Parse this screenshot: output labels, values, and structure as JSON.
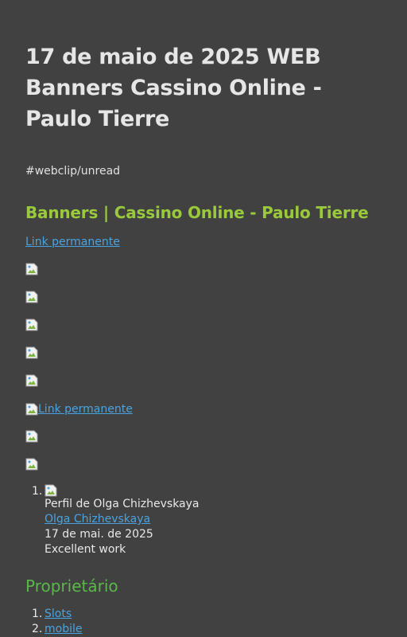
{
  "page": {
    "title": "17 de maio de 2025 WEB Banners Cassino Online - Paulo Tierre",
    "tag": "#webclip/unread",
    "heading": "Banners | Cassino Online - Paulo Tierre",
    "permalink_label": "Link permanente",
    "image_permalink_label": "Link permanente"
  },
  "comments": [
    {
      "index": "1.",
      "profile_alt": "Perfil de Olga Chizhevskaya",
      "author": "Olga Chizhevskaya",
      "date": "17 de mai. de 2025",
      "text": "Excellent work"
    }
  ],
  "owner": {
    "heading": "Proprietário",
    "items": [
      {
        "index": "1.",
        "label": "Slots"
      },
      {
        "index": "2.",
        "label": "mobile"
      }
    ]
  },
  "colors": {
    "background": "#414141",
    "heading_accent": "#9bc93c",
    "owner_heading": "#58b848",
    "link": "#4aa3df"
  }
}
